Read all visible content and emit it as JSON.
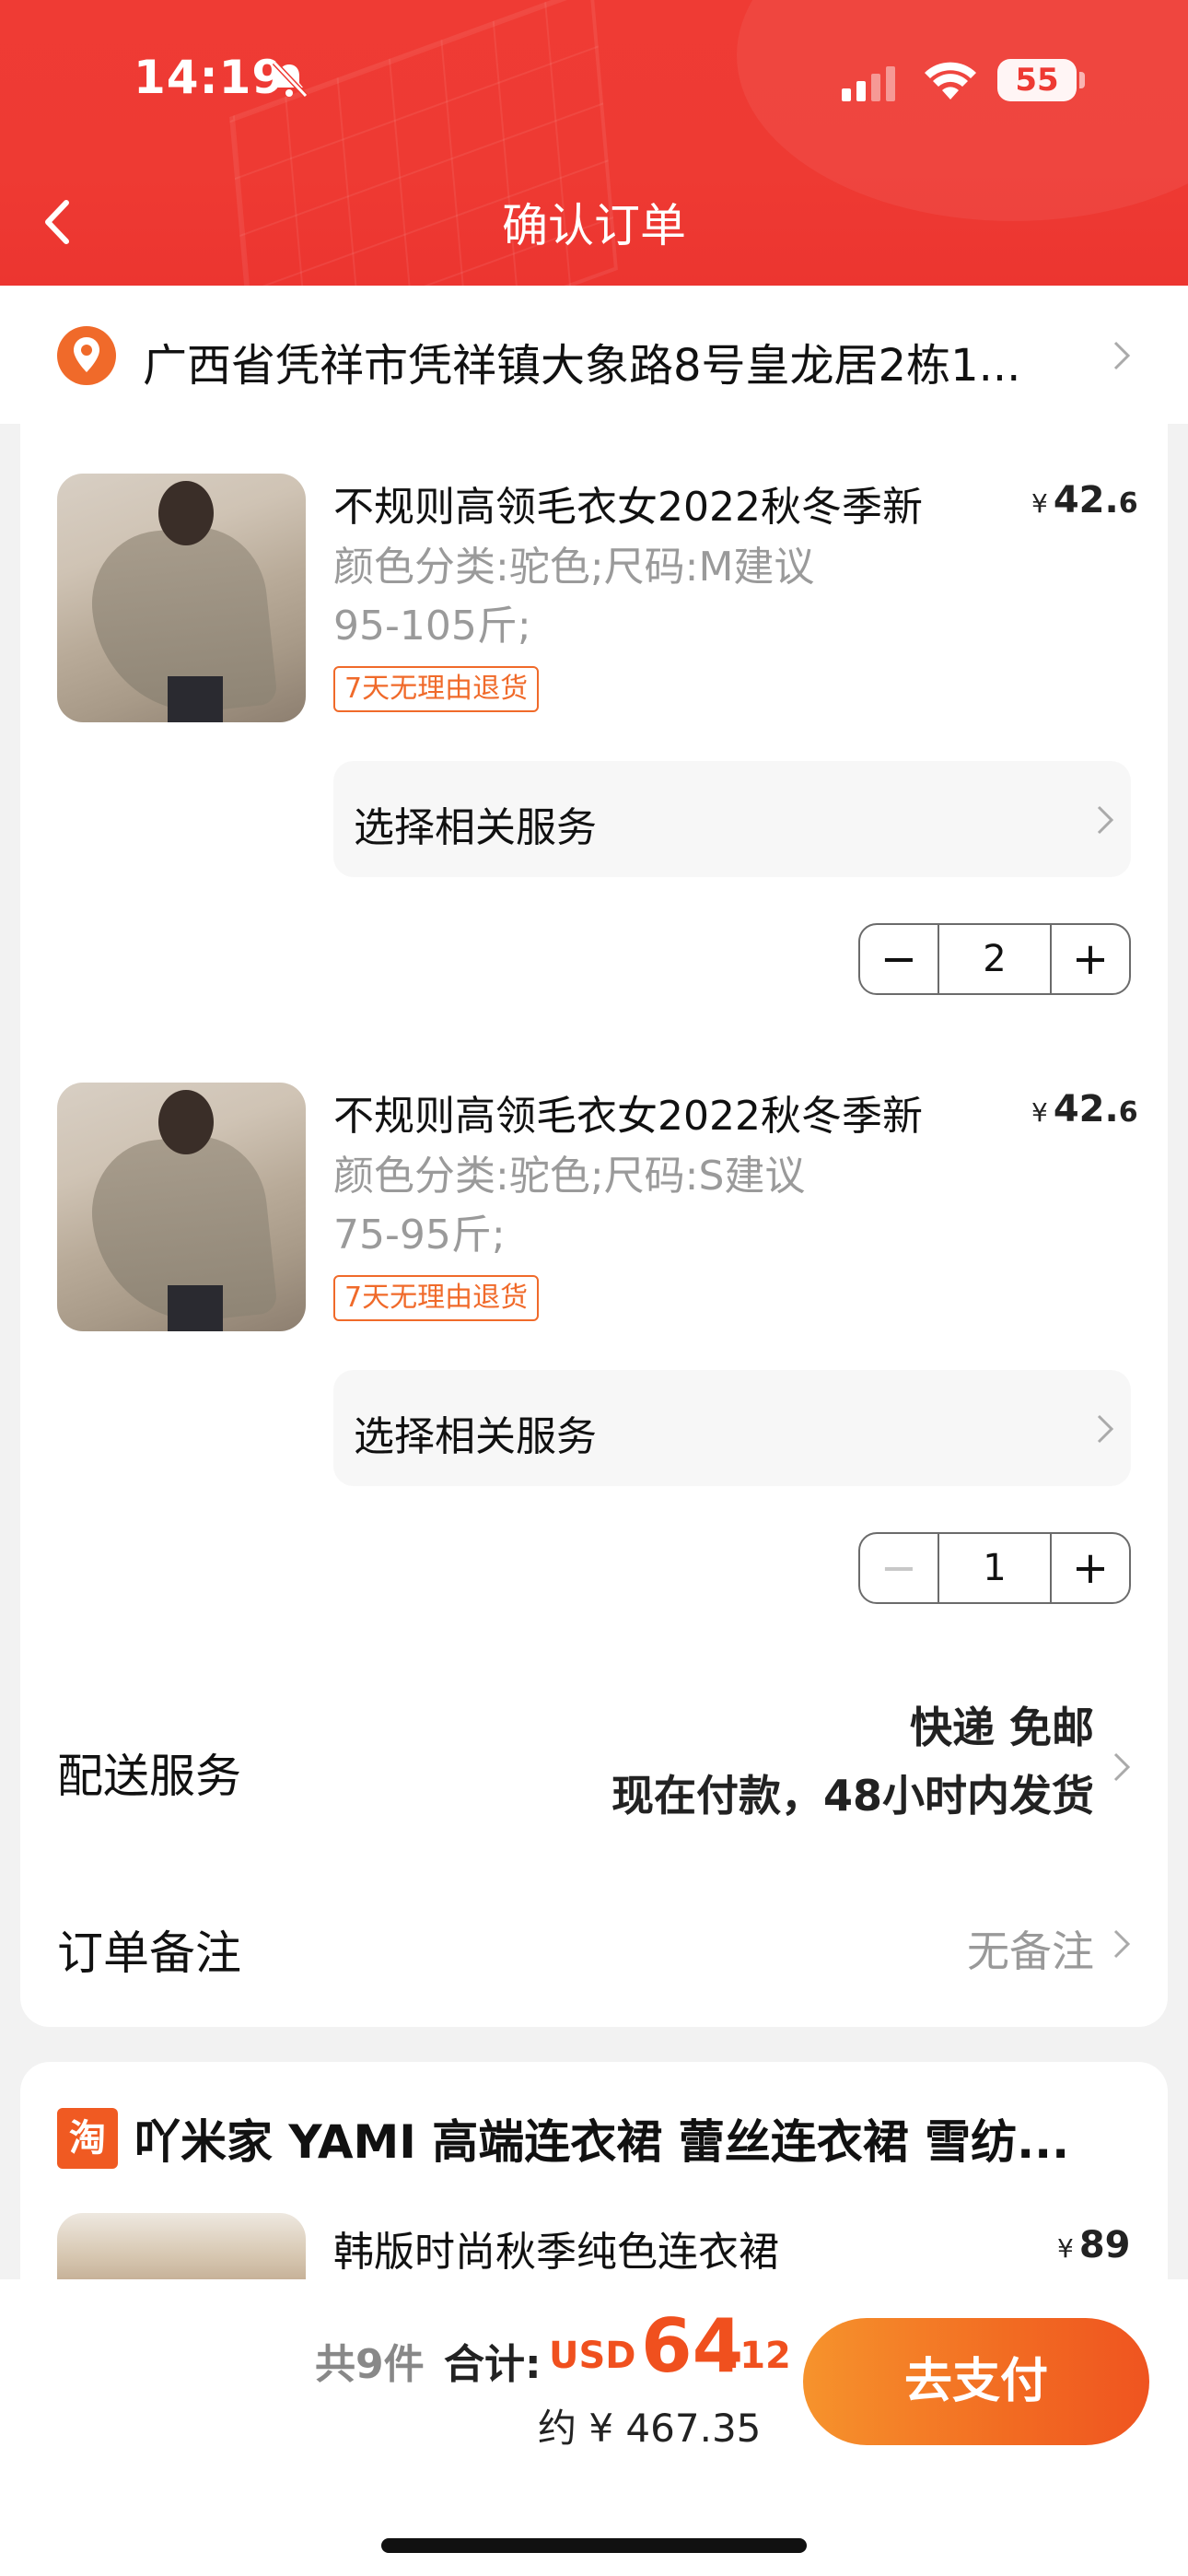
{
  "status_bar": {
    "time": "14:19",
    "battery": "55",
    "icons": [
      "mute-icon",
      "signal-icon",
      "wifi-icon",
      "battery-icon"
    ]
  },
  "nav": {
    "title": "确认订单",
    "back_icon": "chevron-left-icon"
  },
  "address": {
    "text": "广西省凭祥市凭祥镇大象路8号皇龙居2栋1...",
    "icon": "location-pin-icon"
  },
  "items": [
    {
      "title": "不规则高领毛衣女2022秋冬季新",
      "sku_line1": "颜色分类:驼色;尺码:M建议",
      "sku_line2": "95-105斤;",
      "tag": "7天无理由退货",
      "price_symbol": "¥",
      "price_int": "42.",
      "price_dec": "6",
      "service_label": "选择相关服务",
      "quantity": "2",
      "minus": "−",
      "plus": "+"
    },
    {
      "title": "不规则高领毛衣女2022秋冬季新",
      "sku_line1": "颜色分类:驼色;尺码:S建议",
      "sku_line2": "75-95斤;",
      "tag": "7天无理由退货",
      "price_symbol": "¥",
      "price_int": "42.",
      "price_dec": "6",
      "service_label": "选择相关服务",
      "quantity": "1",
      "minus": "−",
      "plus": "+"
    }
  ],
  "delivery": {
    "label": "配送服务",
    "line1": "快递 免邮",
    "line2": "现在付款，48小时内发货"
  },
  "note": {
    "label": "订单备注",
    "value": "无备注"
  },
  "store2": {
    "logo": "淘",
    "name": "吖米家 YAMI 高端连衣裙 蕾丝连衣裙 雪纺...",
    "item_title": "韩版时尚秋季纯色连衣裙",
    "price_symbol": "¥",
    "price": "89"
  },
  "footer": {
    "count": "共9件",
    "total_label": "合计:",
    "currency": "USD",
    "amount_int": "64",
    "amount_dec": ".12",
    "approx": "约 ¥ 467.35",
    "pay_button": "去支付"
  },
  "colors": {
    "header_red": "#ee3a33",
    "accent_orange": "#f0501e",
    "pay_gradient_start": "#f6932c",
    "pay_gradient_end": "#ef5420"
  }
}
